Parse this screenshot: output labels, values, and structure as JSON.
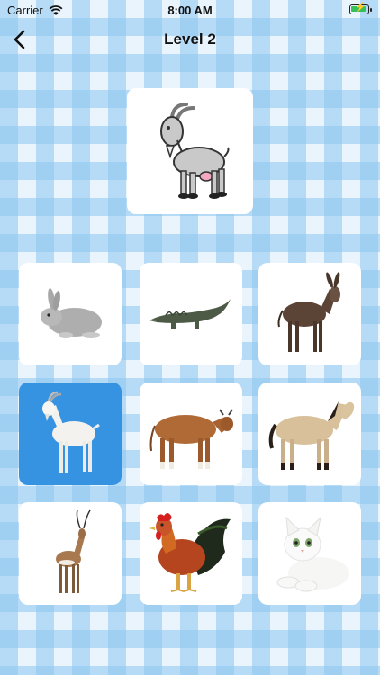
{
  "status_bar": {
    "carrier": "Carrier",
    "time": "8:00 AM",
    "battery_color": "#38c15a"
  },
  "nav": {
    "title": "Level 2",
    "back_icon": "chevron-left-icon"
  },
  "target": {
    "animal": "goat",
    "style": "cartoon"
  },
  "grid": {
    "selected_color": "#3593e2",
    "tiles": [
      {
        "animal": "rabbit",
        "selected": false
      },
      {
        "animal": "crocodile",
        "selected": false
      },
      {
        "animal": "donkey",
        "selected": false
      },
      {
        "animal": "goat",
        "selected": true
      },
      {
        "animal": "cow",
        "selected": false
      },
      {
        "animal": "horse",
        "selected": false
      },
      {
        "animal": "antelope",
        "selected": false
      },
      {
        "animal": "rooster",
        "selected": false
      },
      {
        "animal": "cat",
        "selected": false
      }
    ]
  }
}
